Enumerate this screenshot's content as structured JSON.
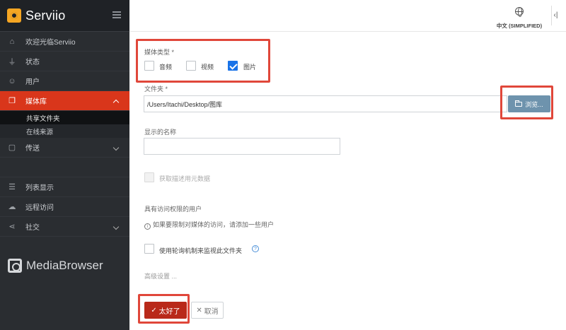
{
  "app": {
    "name": "Serviio"
  },
  "sidebar": {
    "items": [
      {
        "label": "欢迎光临Serviio",
        "icon": "home-icon"
      },
      {
        "label": "状态",
        "icon": "plug-icon"
      },
      {
        "label": "用户",
        "icon": "user-icon"
      },
      {
        "label": "媒体库",
        "icon": "library-icon"
      },
      {
        "label": "传送",
        "icon": "box-icon"
      },
      {
        "label": "列表显示",
        "icon": "list-icon"
      },
      {
        "label": "远程访问",
        "icon": "cloud-icon"
      },
      {
        "label": "社交",
        "icon": "share-icon"
      }
    ],
    "sub_items": [
      "共享文件夹",
      "在线来源"
    ],
    "footer_logo": "MediaBrowser"
  },
  "topbar": {
    "language": "中文 (SIMPLIFIED)",
    "collapse": "‹|"
  },
  "form": {
    "media_type_label": "媒体类型 *",
    "media_types": [
      {
        "label": "音频",
        "checked": false
      },
      {
        "label": "视频",
        "checked": false
      },
      {
        "label": "图片",
        "checked": true
      }
    ],
    "folder_label": "文件夹 *",
    "folder_value": "/Users/Itachi/Desktop/图库",
    "browse_label": "浏览...",
    "display_name_label": "显示的名称",
    "display_name_value": "",
    "metadata_label": "获取描述用元数据",
    "access_label": "具有访问权限的用户",
    "access_info": "如果要限制对媒体的访问，请添加一些用户",
    "polling_label": "使用轮询机制来监视此文件夹",
    "advanced_label": "高级设置 ...",
    "ok_label": "太好了",
    "cancel_label": "取消"
  },
  "colors": {
    "accent": "#d9361b",
    "sidebar_bg": "#2a2d31",
    "browse": "#6e93ad",
    "highlight": "#e0473a"
  }
}
